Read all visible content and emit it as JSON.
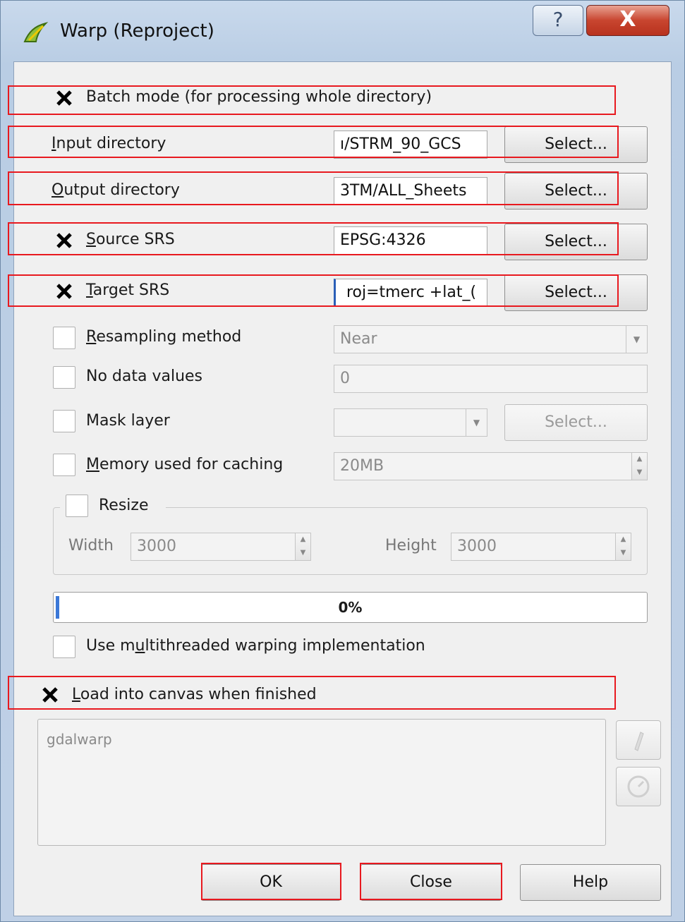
{
  "window": {
    "title": "Warp (Reproject)",
    "help_glyph": "?",
    "close_glyph": "X"
  },
  "batch": {
    "label": "Batch mode (for processing whole directory)",
    "checked": true
  },
  "input_dir": {
    "label_u": "I",
    "label_rest": "nput directory",
    "value": "ı/STRM_90_GCS",
    "button": "Select..."
  },
  "output_dir": {
    "label_u": "O",
    "label_rest": "utput directory",
    "value": "3TM/ALL_Sheets",
    "button": "Select..."
  },
  "source_srs": {
    "label_u": "S",
    "label_rest": "ource SRS",
    "value": "EPSG:4326",
    "button": "Select...",
    "checked": true
  },
  "target_srs": {
    "label_u": "T",
    "label_rest": "arget SRS",
    "value": " roj=tmerc +lat_(",
    "button": "Select...",
    "checked": true
  },
  "resampling": {
    "label_u": "R",
    "label_rest": "esampling method",
    "value": "Near",
    "checked": false
  },
  "nodata": {
    "label": "No data values",
    "value": "0",
    "checked": false
  },
  "mask": {
    "label": "Mask layer",
    "value": "",
    "button": "Select...",
    "checked": false
  },
  "memory": {
    "label_u": "M",
    "label_rest": "emory used for caching",
    "value": "20MB",
    "checked": false
  },
  "resize": {
    "label": "Resize",
    "checked": false,
    "width_label": "Width",
    "width_value": "3000",
    "height_label": "Height",
    "height_value": "3000"
  },
  "progress": {
    "text": "0%",
    "value": 0
  },
  "multithread": {
    "label_pre": "Use m",
    "label_u": "u",
    "label_post": "ltithreaded warping implementation",
    "checked": false
  },
  "load_canvas": {
    "label_u": "L",
    "label_rest": "oad into canvas when finished",
    "checked": true
  },
  "command": {
    "text": "gdalwarp"
  },
  "buttons": {
    "ok": "OK",
    "close": "Close",
    "help": "Help"
  },
  "icons": {
    "app": "qgis-warp-icon",
    "edit": "pencil-icon",
    "reset": "reset-icon"
  },
  "colors": {
    "highlight": "#e8191f",
    "accent": "#3b78d8"
  }
}
